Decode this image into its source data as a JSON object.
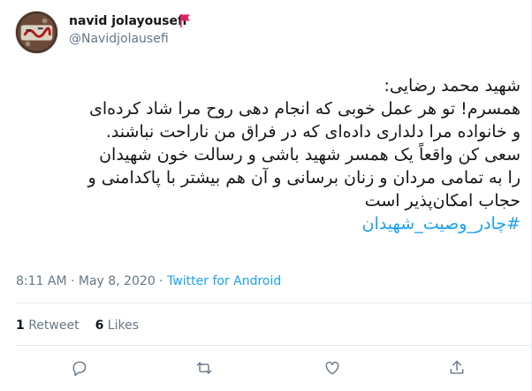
{
  "author": {
    "display_name": "navid jolayousefi",
    "handle": "@Navidjolausefi"
  },
  "tweet": {
    "lines": [
      "شهید محمد رضایی:",
      "همسرم! تو هر عمل خوبی که انجام دهی روح مرا شاد کرده‌ای",
      "و خانواده مرا دلداری داده‌ای که در فراق من ناراحت نباشند.",
      "سعی کن واقعاً یک همسر شهید باشی و رسالت خون شهیدان",
      "را به تمامی مردان و زنان برسانی و آن هم بیشتر با پاکدامنی و",
      "حجاب امکان‌پذیر است"
    ],
    "hashtag": "#چادر_وصیت_شهیدان"
  },
  "meta": {
    "time": "8:11 AM · May 8, 2020 · ",
    "source": "Twitter for Android"
  },
  "stats": {
    "retweets_count": "1",
    "retweets_label": "Retweet",
    "likes_count": "6",
    "likes_label": "Likes"
  },
  "actions": [
    "reply-icon",
    "retweet-icon",
    "like-icon",
    "share-icon"
  ],
  "colors": {
    "link": "#1da1f2",
    "secondary_text": "#657786",
    "flag": "#e0245e"
  }
}
